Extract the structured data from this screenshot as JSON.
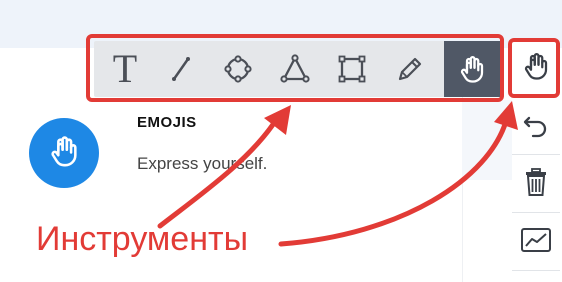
{
  "card": {
    "title": "EMOJIS",
    "subtitle": "Express yourself."
  },
  "toolbar": {
    "tools": [
      {
        "icon": "text-icon",
        "glyph": "T"
      },
      {
        "icon": "line-icon"
      },
      {
        "icon": "circle-icon"
      },
      {
        "icon": "triangle-icon"
      },
      {
        "icon": "rectangle-icon"
      },
      {
        "icon": "pencil-icon"
      },
      {
        "icon": "hand-icon",
        "active": true
      }
    ]
  },
  "side_tools": [
    {
      "icon": "hand-icon"
    },
    {
      "icon": "undo-icon"
    },
    {
      "icon": "trash-icon"
    },
    {
      "icon": "chart-icon"
    }
  ],
  "annotation": {
    "label": "Инструменты",
    "color": "#e23b36"
  },
  "colors": {
    "accent": "#1e88e5",
    "toolbar_bg": "#e5e7ea",
    "active_tool": "#505866"
  }
}
